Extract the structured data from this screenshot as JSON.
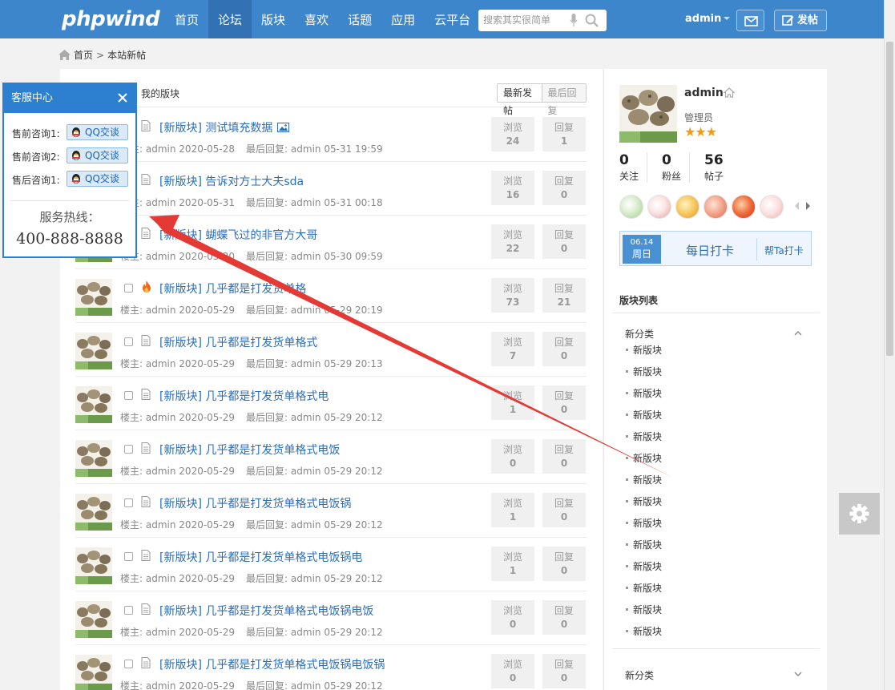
{
  "header": {
    "logo": "phpwind",
    "nav": [
      "首页",
      "论坛",
      "版块",
      "喜欢",
      "话题",
      "应用",
      "云平台"
    ],
    "active_nav": 1,
    "search_placeholder": "搜索其实很简单",
    "user": "admin",
    "post_label": "发帖"
  },
  "breadcrumb": {
    "home": "首页",
    "current": "本站新帖"
  },
  "tabs": {
    "my_forums": "我的版块",
    "latest": "最新发帖",
    "latest_reply": "最后回复"
  },
  "threads": [
    {
      "title": "[新版块] 测试填充数据",
      "owner": "楼主: admin",
      "date": "2020-05-28",
      "last": "最后回复: admin",
      "last_time": "05-31 19:59",
      "views_label": "浏览",
      "views": "24",
      "replies_label": "回复",
      "replies": "1",
      "icon": "doc",
      "has_image": true
    },
    {
      "title": "[新版块] 告诉对方士大夫sda",
      "owner": "楼主: admin",
      "date": "2020-05-31",
      "last": "最后回复: admin",
      "last_time": "05-31 00:18",
      "views_label": "浏览",
      "views": "16",
      "replies_label": "回复",
      "replies": "0",
      "icon": "doc"
    },
    {
      "title": "[新版块] 蝴蝶飞过的非官方大哥",
      "owner": "楼主: admin",
      "date": "2020-05-30",
      "last": "最后回复: admin",
      "last_time": "05-30 09:59",
      "views_label": "浏览",
      "views": "22",
      "replies_label": "回复",
      "replies": "0",
      "icon": "doc"
    },
    {
      "title": "[新版块] 几乎都是打发货单格",
      "owner": "楼主: admin",
      "date": "2020-05-29",
      "last": "最后回复: admin",
      "last_time": "05-29 20:19",
      "views_label": "浏览",
      "views": "73",
      "replies_label": "回复",
      "replies": "21",
      "icon": "fire"
    },
    {
      "title": "[新版块] 几乎都是打发货单格式",
      "owner": "楼主: admin",
      "date": "2020-05-29",
      "last": "最后回复: admin",
      "last_time": "05-29 20:13",
      "views_label": "浏览",
      "views": "7",
      "replies_label": "回复",
      "replies": "0",
      "icon": "doc"
    },
    {
      "title": "[新版块] 几乎都是打发货单格式电",
      "owner": "楼主: admin",
      "date": "2020-05-29",
      "last": "最后回复: admin",
      "last_time": "05-29 20:12",
      "views_label": "浏览",
      "views": "1",
      "replies_label": "回复",
      "replies": "0",
      "icon": "doc"
    },
    {
      "title": "[新版块] 几乎都是打发货单格式电饭",
      "owner": "楼主: admin",
      "date": "2020-05-29",
      "last": "最后回复: admin",
      "last_time": "05-29 20:12",
      "views_label": "浏览",
      "views": "0",
      "replies_label": "回复",
      "replies": "0",
      "icon": "doc"
    },
    {
      "title": "[新版块] 几乎都是打发货单格式电饭锅",
      "owner": "楼主: admin",
      "date": "2020-05-29",
      "last": "最后回复: admin",
      "last_time": "05-29 20:12",
      "views_label": "浏览",
      "views": "1",
      "replies_label": "回复",
      "replies": "0",
      "icon": "doc"
    },
    {
      "title": "[新版块] 几乎都是打发货单格式电饭锅电",
      "owner": "楼主: admin",
      "date": "2020-05-29",
      "last": "最后回复: admin",
      "last_time": "05-29 20:12",
      "views_label": "浏览",
      "views": "1",
      "replies_label": "回复",
      "replies": "0",
      "icon": "doc"
    },
    {
      "title": "[新版块] 几乎都是打发货单格式电饭锅电饭",
      "owner": "楼主: admin",
      "date": "2020-05-29",
      "last": "最后回复: admin",
      "last_time": "05-29 20:12",
      "views_label": "浏览",
      "views": "0",
      "replies_label": "回复",
      "replies": "0",
      "icon": "doc"
    },
    {
      "title": "[新版块] 几乎都是打发货单格式电饭锅电饭锅",
      "owner": "楼主: admin",
      "date": "2020-05-29",
      "last": "最后回复: admin",
      "last_time": "05-29 20:12",
      "views_label": "浏览",
      "views": "0",
      "replies_label": "回复",
      "replies": "0",
      "icon": "doc"
    }
  ],
  "profile": {
    "name": "admin",
    "role": "管理员",
    "stars": "★★★",
    "following": "0",
    "following_label": "关注",
    "fans": "0",
    "fans_label": "粉丝",
    "posts": "56",
    "posts_label": "帖子",
    "checkin_date": "06.14",
    "checkin_weekday": "周日",
    "checkin_label": "每日打卡",
    "checkin_help": "帮Ta打卡"
  },
  "forum_list": {
    "title": "版块列表",
    "category": "新分类",
    "items": [
      "新版块",
      "新版块",
      "新版块",
      "新版块",
      "新版块",
      "新版块",
      "新版块",
      "新版块",
      "新版块",
      "新版块",
      "新版块",
      "新版块",
      "新版块",
      "新版块"
    ],
    "category2": "新分类"
  },
  "service": {
    "title": "客服中心",
    "rows": [
      {
        "label": "售前咨询1:",
        "button": "QQ交谈"
      },
      {
        "label": "售前咨询2:",
        "button": "QQ交谈"
      },
      {
        "label": "售后咨询1:",
        "button": "QQ交谈"
      }
    ],
    "hotline_label": "服务热线：",
    "hotline": "400-888-8888"
  },
  "colors": {
    "header": "#3e86cb",
    "link": "#2a6eb8",
    "widget": "#2d7fd0",
    "annotation_arrow": "#e53935"
  }
}
